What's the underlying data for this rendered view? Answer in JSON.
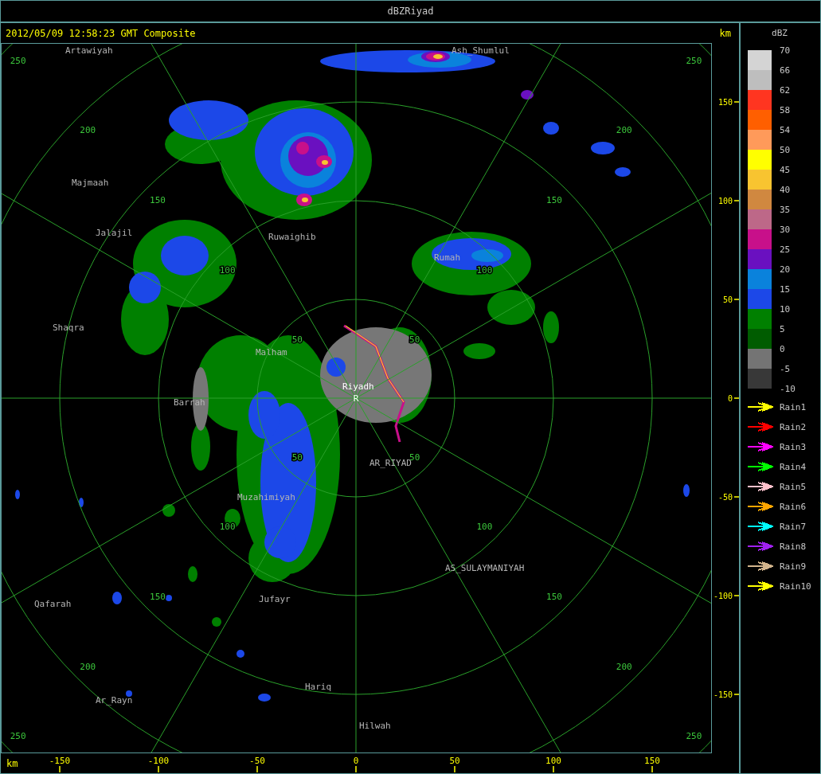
{
  "window": {
    "title": "dBZRiyad"
  },
  "header": {
    "timestamp": "2012/05/09 12:58:23 GMT Composite",
    "unit": "km"
  },
  "map": {
    "center_label": "Riyadh",
    "radar_mark": "R",
    "places": [
      {
        "name": "Artawiyah"
      },
      {
        "name": "Ash_Shumlul"
      },
      {
        "name": "Majmaah"
      },
      {
        "name": "Jalajil"
      },
      {
        "name": "Ruwaighib"
      },
      {
        "name": "Rumah"
      },
      {
        "name": "Shaqra"
      },
      {
        "name": "Malham"
      },
      {
        "name": "Barrah"
      },
      {
        "name": "AR_RIYAD"
      },
      {
        "name": "Muzahimiyah"
      },
      {
        "name": "AS_SULAYMANIYAH"
      },
      {
        "name": "Jufayr"
      },
      {
        "name": "Qafarah"
      },
      {
        "name": "Hariq"
      },
      {
        "name": "Ar_Rayn"
      },
      {
        "name": "Hilwah"
      }
    ],
    "range_rings": [
      {
        "labels": [
          "50",
          "50",
          "50",
          "50"
        ]
      },
      {
        "labels": [
          "100",
          "100",
          "100",
          "100"
        ]
      },
      {
        "labels": [
          "150",
          "150",
          "150",
          "150"
        ]
      },
      {
        "labels": [
          "200",
          "200",
          "200",
          "200"
        ]
      },
      {
        "labels": [
          "250",
          "250",
          "250",
          "250"
        ]
      }
    ]
  },
  "y_axis": {
    "ticks": [
      "150",
      "100",
      "50",
      "0",
      "-50",
      "-100",
      "-150"
    ]
  },
  "x_axis": {
    "unit": "km",
    "ticks": [
      "-150",
      "-100",
      "-50",
      "0",
      "50",
      "100",
      "150"
    ]
  },
  "legend": {
    "title": "dBZ",
    "swatches": [
      {
        "color": "#d4d4d4"
      },
      {
        "color": "#bebebe"
      },
      {
        "color": "#ff3520"
      },
      {
        "color": "#ff5f00"
      },
      {
        "color": "#ff9a5a"
      },
      {
        "color": "#ffff00"
      },
      {
        "color": "#f8c430"
      },
      {
        "color": "#d08840"
      },
      {
        "color": "#bd6888"
      },
      {
        "color": "#c8108a"
      },
      {
        "color": "#6a10c0"
      },
      {
        "color": "#0a82dc"
      },
      {
        "color": "#1c48e8"
      },
      {
        "color": "#008000"
      },
      {
        "color": "#005c00"
      },
      {
        "color": "#747474"
      },
      {
        "color": "#383838"
      }
    ],
    "scale_labels": [
      "70",
      "66",
      "62",
      "58",
      "54",
      "50",
      "45",
      "40",
      "35",
      "30",
      "25",
      "20",
      "15",
      "10",
      "5",
      "0",
      "-5",
      "-10"
    ],
    "tracks": [
      {
        "label": "Rain1",
        "color": "#ffff00"
      },
      {
        "label": "Rain2",
        "color": "#ff0000"
      },
      {
        "label": "Rain3",
        "color": "#ff00ff"
      },
      {
        "label": "Rain4",
        "color": "#00ff00"
      },
      {
        "label": "Rain5",
        "color": "#ffc0cb"
      },
      {
        "label": "Rain6",
        "color": "#ffa500"
      },
      {
        "label": "Rain7",
        "color": "#00ffff"
      },
      {
        "label": "Rain8",
        "color": "#a020f0"
      },
      {
        "label": "Rain9",
        "color": "#d2b48c"
      },
      {
        "label": "Rain10",
        "color": "#ffff00"
      }
    ]
  }
}
